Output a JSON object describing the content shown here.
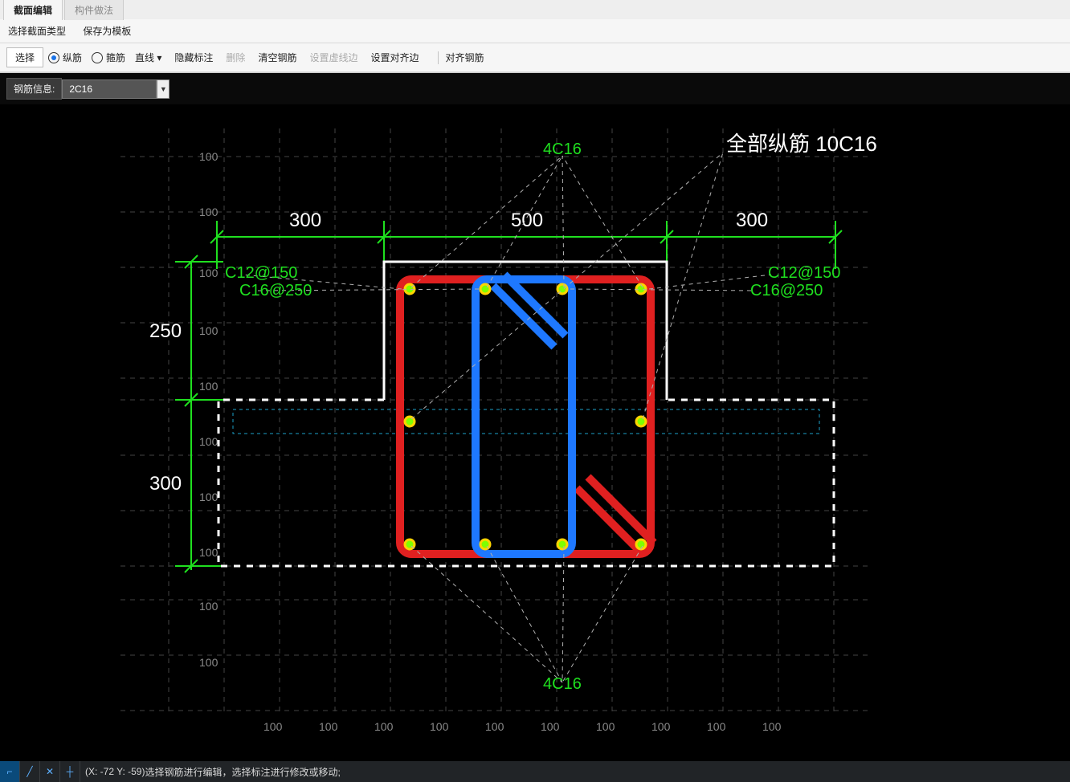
{
  "tabs": {
    "t0": "截面编辑",
    "t1": "构件做法"
  },
  "menu": {
    "m0": "选择截面类型",
    "m1": "保存为模板"
  },
  "toolbar": {
    "select": "选择",
    "r_long": "纵筋",
    "r_stir": "箍筋",
    "line": "直线 ▾",
    "hide": "隐藏标注",
    "del": "删除",
    "clear": "清空钢筋",
    "vedge": "设置虚线边",
    "align_side": "设置对齐边",
    "align_bar": "对齐钢筋"
  },
  "info": {
    "label": "钢筋信息:",
    "value": "2C16"
  },
  "draw": {
    "title": "全部纵筋  10C16",
    "top_label": "4C16",
    "bot_label": "4C16",
    "stirrup_left1": "C12@150",
    "stirrup_left2": "C16@250",
    "stirrup_right1": "C12@150",
    "stirrup_right2": "C16@250",
    "d_left": "300",
    "d_mid": "500",
    "d_right": "300",
    "h1": "250",
    "h2": "300",
    "tick": "100"
  },
  "grid_ticks": [
    "100",
    "100",
    "100",
    "100",
    "100",
    "100",
    "100",
    "100",
    "100",
    "100",
    "100",
    "100",
    "100"
  ],
  "status": {
    "coord": "(X: -72 Y: -59)",
    "msg": "选择钢筋进行编辑，选择标注进行修改或移动;"
  }
}
